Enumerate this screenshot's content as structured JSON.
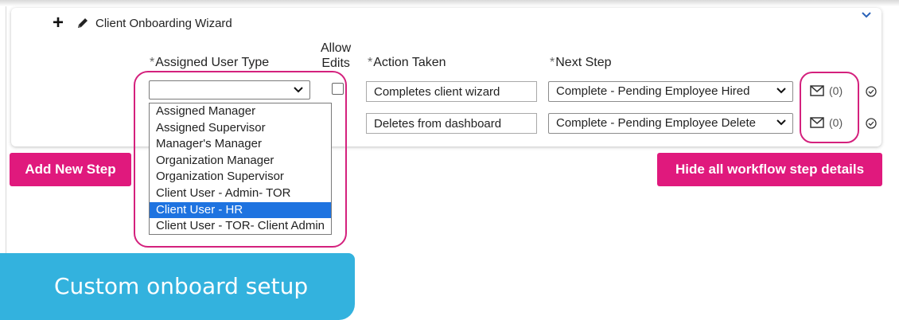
{
  "wizard": {
    "title": "Client Onboarding Wizard",
    "icons": {
      "add": "plus-icon",
      "edit": "pencil-icon",
      "collapse": "chevron-down-icon"
    }
  },
  "columns": {
    "required_mark": "*",
    "assigned_user_type": "Assigned User Type",
    "allow_edits_line1": "Allow",
    "allow_edits_line2": "Edits",
    "action_taken": "Action Taken",
    "next_step": "Next Step"
  },
  "rows": [
    {
      "assigned_user_type": "",
      "allow_edits": false,
      "action_taken": "Completes client wizard",
      "next_step": "Complete - Pending Employee Hired",
      "mail_count": "(0)"
    },
    {
      "action_taken": "Deletes from dashboard",
      "next_step": "Complete - Pending Employee Delete",
      "mail_count": "(0)"
    }
  ],
  "assigned_user_type_options": [
    "Assigned Manager",
    "Assigned Supervisor",
    "Manager's Manager",
    "Organization Manager",
    "Organization Supervisor",
    "Client User - Admin- TOR",
    "Client User - HR",
    "Client User - TOR- Client Admin"
  ],
  "highlighted_option": "Client User - HR",
  "buttons": {
    "add_new_step": "Add New Step",
    "hide_details": "Hide all workflow step details"
  },
  "callout": {
    "text": "Custom onboard setup"
  },
  "colors": {
    "accent_pink": "#e0197d",
    "highlight_ring": "#d4217d",
    "callout_blue": "#33b2de",
    "selected_option": "#1e73e0"
  }
}
